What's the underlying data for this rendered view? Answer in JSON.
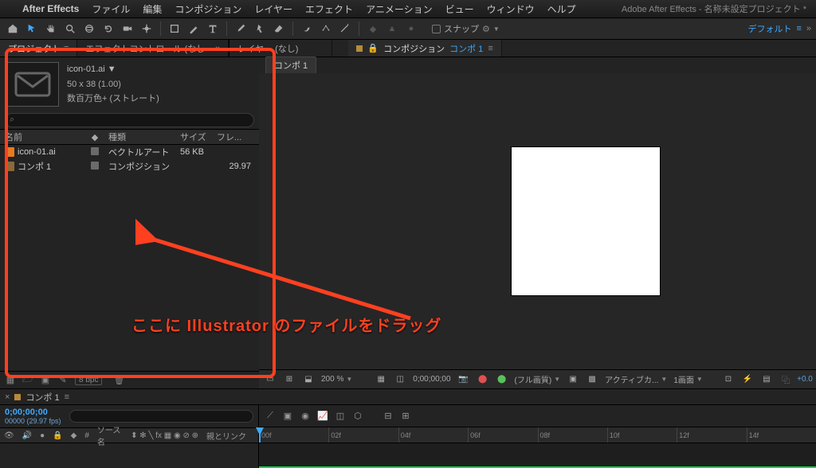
{
  "menubar": {
    "app": "After Effects",
    "items": [
      "ファイル",
      "編集",
      "コンポジション",
      "レイヤー",
      "エフェクト",
      "アニメーション",
      "ビュー",
      "ウィンドウ",
      "ヘルプ"
    ],
    "window_title": "Adobe After Effects - 名称未設定プロジェクト *"
  },
  "toolbar": {
    "snap_label": "スナップ",
    "workspace": "デフォルト"
  },
  "project_panel": {
    "tab_project": "プロジェクト",
    "tab_effect": "エフェクトコントロール (なし",
    "item_name": "icon-01.ai ▼",
    "item_dims": "50 x 38 (1.00)",
    "item_color": "数百万色+ (ストレート)",
    "cols": {
      "name": "名前",
      "tag": "🔖",
      "type": "種類",
      "size": "サイズ",
      "fr": "フレ..."
    },
    "rows": [
      {
        "name": "icon-01.ai",
        "type": "ベクトルアート",
        "size": "56 KB",
        "fr": ""
      },
      {
        "name": "コンポ 1",
        "type": "コンポジション",
        "size": "",
        "fr": "29.97"
      }
    ],
    "bpc": "8 bpc"
  },
  "viewer": {
    "tab_layer": "レイヤー (なし)",
    "bc_label": "コンポジション",
    "bc_name": "コンポ 1",
    "subtab": "コンポ 1",
    "zoom": "200 %",
    "timecode": "0;00;00;00",
    "quality": "(フル画質)",
    "camera": "アクティブカ...",
    "views": "1画面"
  },
  "timeline": {
    "tab": "コンポ 1",
    "tc": "0;00;00;00",
    "tc_sub": "00000 (29.97 fps)",
    "col_source": "ソース名",
    "col_parent": "親とリンク",
    "ruler": [
      "00f",
      "02f",
      "04f",
      "06f",
      "08f",
      "10f",
      "12f",
      "14f"
    ]
  },
  "annotation": {
    "text": "ここに Illustrator のファイルをドラッグ"
  }
}
